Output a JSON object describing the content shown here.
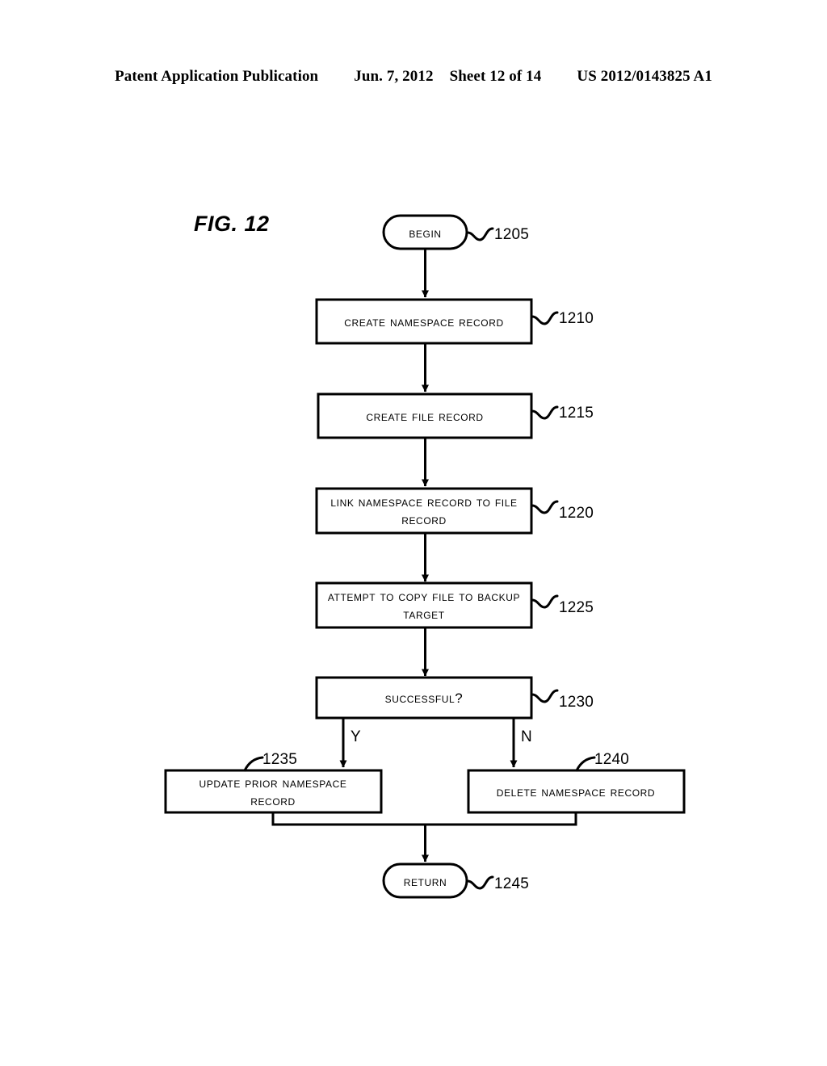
{
  "header": {
    "publication": "Patent Application Publication",
    "date": "Jun. 7, 2012",
    "sheet": "Sheet 12 of 14",
    "patent_number": "US 2012/0143825 A1"
  },
  "figure": {
    "title": "FIG. 12"
  },
  "nodes": {
    "begin": {
      "label": "Begin",
      "ref": "1205",
      "shape": "oval"
    },
    "create_namespace": {
      "label": "Create Namespace Record",
      "ref": "1210",
      "shape": "rect"
    },
    "create_file": {
      "label": "Create File Record",
      "ref": "1215",
      "shape": "rect"
    },
    "link_records": {
      "line1": "Link Namespace Record to File",
      "line2": "Record",
      "ref": "1220",
      "shape": "rect"
    },
    "attempt_copy": {
      "line1": "Attempt to Copy File to Backup",
      "line2": "Target",
      "ref": "1225",
      "shape": "rect"
    },
    "successful": {
      "label": "Successful?",
      "ref": "1230",
      "shape": "rect"
    },
    "update_prior": {
      "line1": "Update Prior Namespace",
      "line2": "Record",
      "ref": "1235",
      "shape": "rect"
    },
    "delete_namespace": {
      "label": "Delete Namespace Record",
      "ref": "1240",
      "shape": "rect"
    },
    "return": {
      "label": "Return",
      "ref": "1245",
      "shape": "oval"
    }
  },
  "branches": {
    "yes": "Y",
    "no": "N"
  },
  "colors": {
    "ink": "#000000",
    "paper": "#ffffff"
  }
}
